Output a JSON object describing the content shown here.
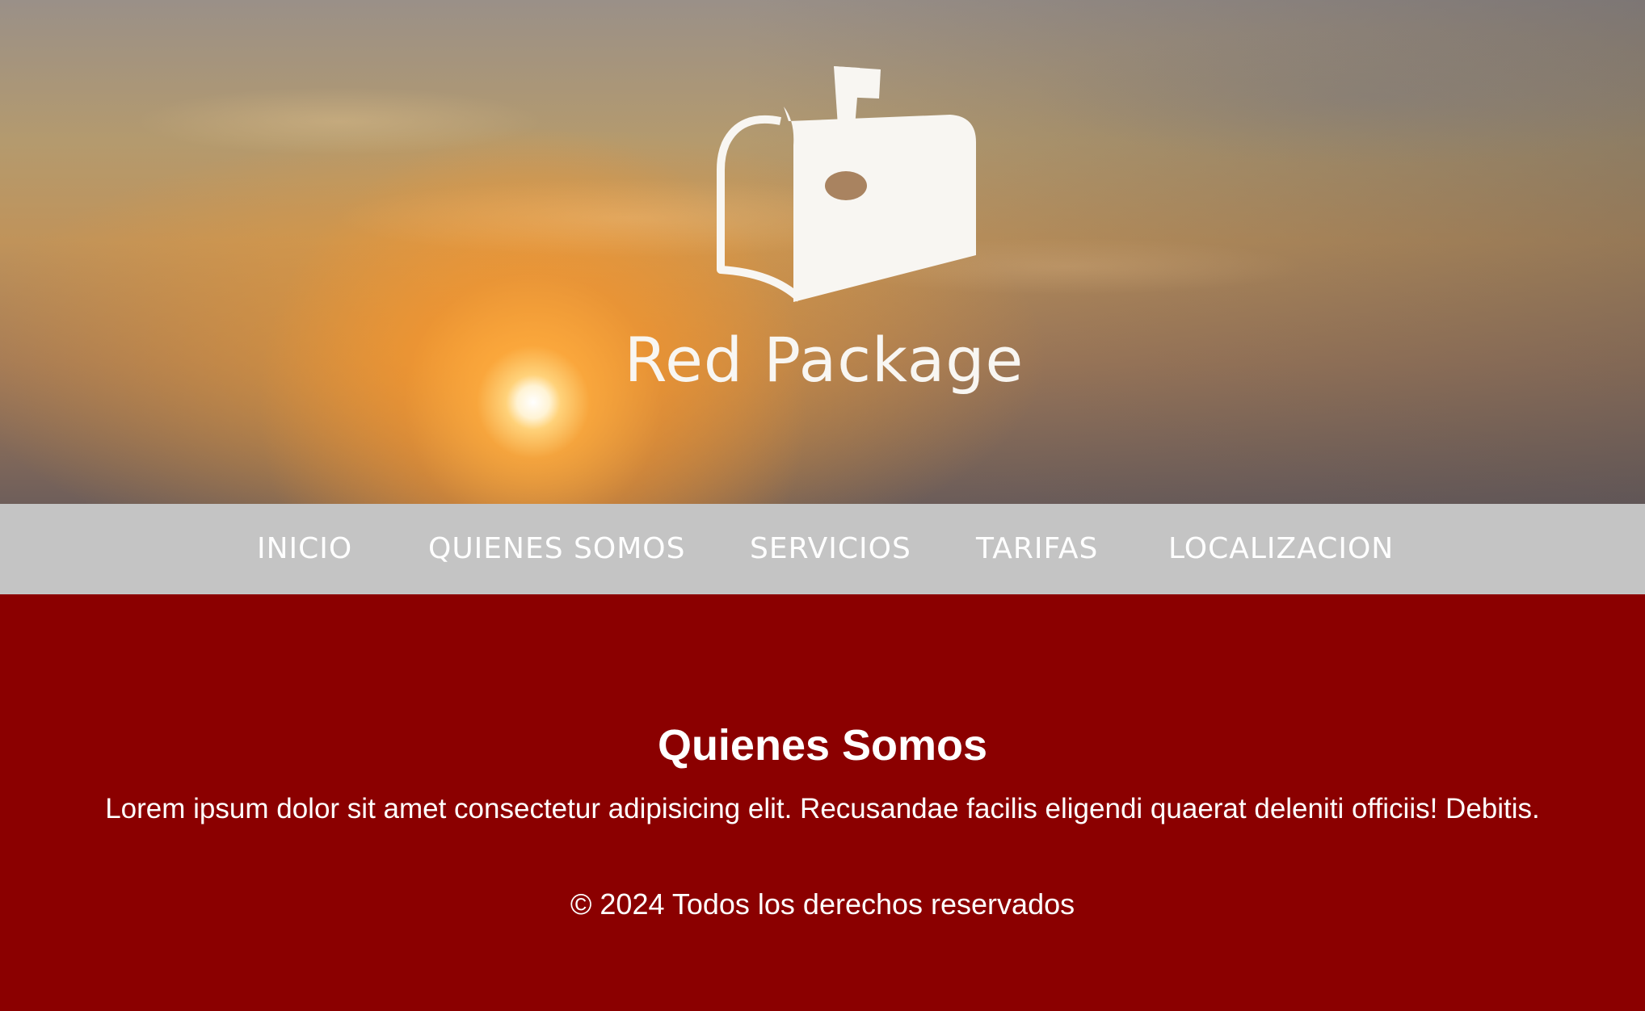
{
  "brand": {
    "name": "Red Package",
    "logo_icon": "mailbox-icon"
  },
  "nav": {
    "items": [
      {
        "label": "INICIO"
      },
      {
        "label": "QUIENES SOMOS"
      },
      {
        "label": "SERVICIOS"
      },
      {
        "label": "TARIFAS"
      },
      {
        "label": "LOCALIZACION"
      }
    ]
  },
  "section": {
    "title": "Quienes Somos",
    "text": "Lorem ipsum dolor sit amet consectetur adipisicing elit. Recusandae facilis eligendi quaerat deleniti officiis! Debitis."
  },
  "footer": {
    "text": "© 2024 Todos los derechos reservados"
  },
  "colors": {
    "primary_red": "#8b0000",
    "nav_background": "#c4c4c4",
    "text": "#ffffff",
    "logo": "#f8f6f2"
  }
}
